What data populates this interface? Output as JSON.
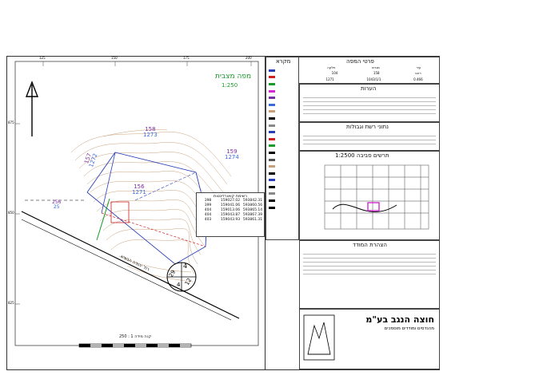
{
  "map": {
    "title": "מפה מצבית",
    "scale": "1:250",
    "scale_bar_label": "קנה מידה 1 : 250",
    "street_label": "רח' יהודה הנשיא",
    "grid_left": [
      "875",
      "850",
      "825"
    ],
    "grid_top": [
      "125",
      "150",
      "175",
      "200"
    ],
    "parcels": [
      {
        "num": "158",
        "sub": "1273"
      },
      {
        "num": "159",
        "sub": "1274"
      },
      {
        "num": "157",
        "sub": "1272"
      },
      {
        "num": "156",
        "sub": "1271"
      },
      {
        "num": "155",
        "sub": "1270"
      },
      {
        "num": "256",
        "sub": "25"
      }
    ],
    "block_digits": [
      "4",
      "29",
      "12",
      "4"
    ]
  },
  "title_block": {
    "header": "פרטי המפה",
    "legend_header": "מקרא",
    "notes_header": "הערות",
    "sources_header": "נתוני רשת וגבולות",
    "location_header": "תרשים סביבה 1:2500",
    "surveyor_header": "הצהרת המודד",
    "company_name": "חוצה הנגב בע\"מ",
    "company_sub": "מהנדסים ומודדים מוסמכים",
    "table_header": "רשימת קואורדינטות",
    "row1": [
      "גוש",
      "חלקה",
      "מגרש",
      "עיר"
    ],
    "row1_values": [
      "39663",
      "104",
      "158",
      "רהט"
    ],
    "area_values": [
      "0.469",
      "1271",
      "1043/1/1",
      "0.466"
    ]
  },
  "coord_table": [
    [
      "398",
      "159027.02",
      "593842.31"
    ],
    [
      "399",
      "159041.06",
      "593860.56"
    ],
    [
      "404",
      "159013.06",
      "593865.14"
    ],
    [
      "404",
      "159043.87",
      "593867.39"
    ],
    [
      "403",
      "159043.93",
      "593861.31"
    ]
  ],
  "colors": {
    "parcel_label": "#7a2fa0",
    "block_label": "#3a6ad8",
    "boundary": "#2a3fb5",
    "contour": "#c7a07a",
    "building": "#c22",
    "green": "#1a9a2a",
    "site": "#d02ad0"
  }
}
